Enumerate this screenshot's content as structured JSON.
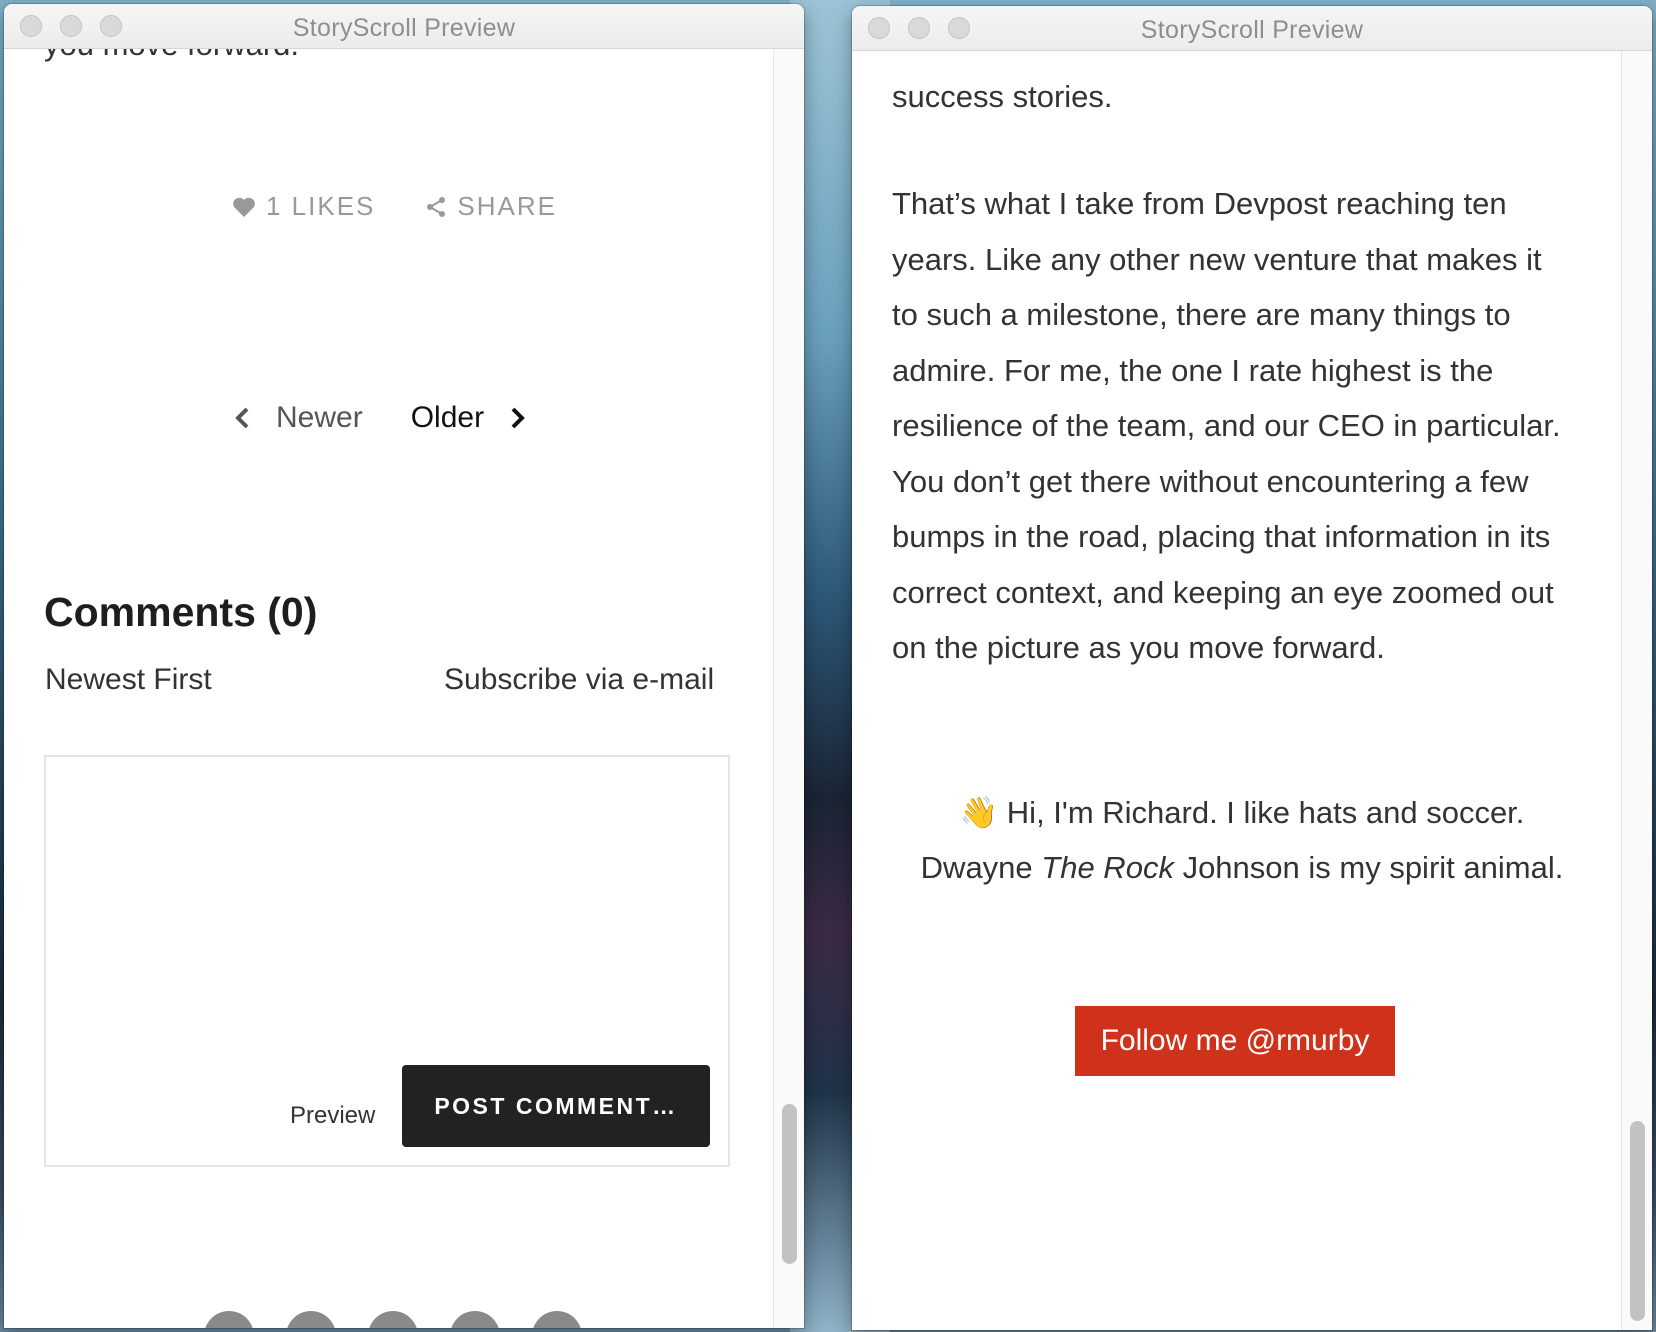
{
  "windows": [
    {
      "title": "StoryScroll Preview",
      "top_fragment": "you move forward.",
      "likes_label": "1 LIKES",
      "share_label": "SHARE",
      "newer_label": "Newer",
      "older_label": "Older",
      "comments_heading": "Comments (0)",
      "sort_label": "Newest First",
      "subscribe_label": "Subscribe via e-mail",
      "preview_label": "Preview",
      "post_button": "POST COMMENT…"
    },
    {
      "title": "StoryScroll Preview",
      "para1_tail": "success stories.",
      "para2": "That’s what I take from Devpost reaching ten years. Like any other new venture that makes it to such a milestone, there are many things to admire. For me, the one I rate highest is the resilience of the team, and our CEO in particular. You don’t get there without encountering a few bumps in the road, placing that information in its correct context, and keeping an eye zoomed out on the picture as you move forward.",
      "bio_wave": "👋",
      "bio_line": "Hi, I'm Richard. I like hats and soccer.",
      "bio_pre": "Dwayne ",
      "bio_em": "The Rock",
      "bio_post": " Johnson is my spirit animal.",
      "follow_button": "Follow me @rmurby"
    }
  ]
}
